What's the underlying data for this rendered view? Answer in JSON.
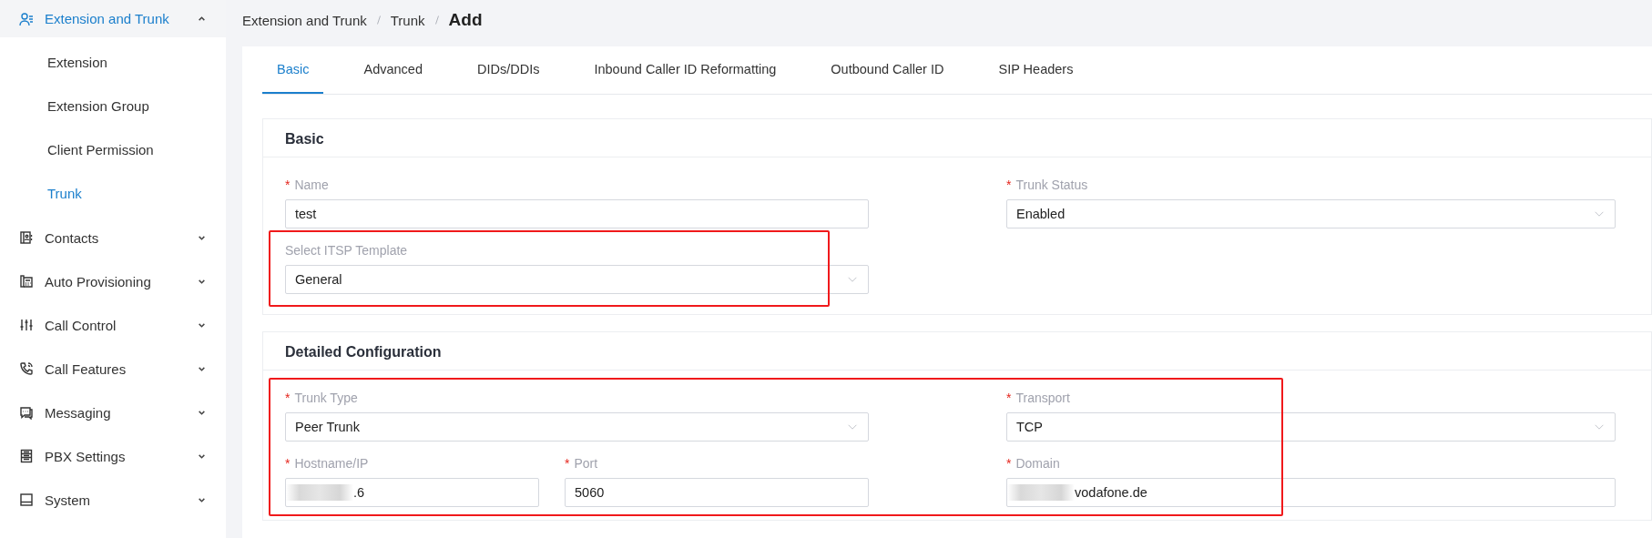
{
  "sidebar": {
    "items": [
      {
        "label": "Extension and Trunk",
        "expanded": true,
        "children": [
          {
            "label": "Extension",
            "selected": false
          },
          {
            "label": "Extension Group",
            "selected": false
          },
          {
            "label": "Client Permission",
            "selected": false
          },
          {
            "label": "Trunk",
            "selected": true
          }
        ]
      },
      {
        "label": "Contacts",
        "expanded": false
      },
      {
        "label": "Auto Provisioning",
        "expanded": false
      },
      {
        "label": "Call Control",
        "expanded": false
      },
      {
        "label": "Call Features",
        "expanded": false
      },
      {
        "label": "Messaging",
        "expanded": false
      },
      {
        "label": "PBX Settings",
        "expanded": false
      },
      {
        "label": "System",
        "expanded": false
      }
    ]
  },
  "breadcrumb": [
    "Extension and Trunk",
    "Trunk"
  ],
  "page_title": "Add",
  "tabs": [
    {
      "label": "Basic",
      "selected": true
    },
    {
      "label": "Advanced",
      "selected": false
    },
    {
      "label": "DIDs/DDIs",
      "selected": false
    },
    {
      "label": "Inbound Caller ID Reformatting",
      "selected": false
    },
    {
      "label": "Outbound Caller ID",
      "selected": false
    },
    {
      "label": "SIP Headers",
      "selected": false
    }
  ],
  "sections": [
    {
      "title": "Basic",
      "groups": [
        {
          "highlighted": false,
          "rows": [
            {
              "fields": [
                {
                  "kind": "text",
                  "required_mark": "*",
                  "label": "Name",
                  "value": "test"
                },
                {
                  "kind": "select",
                  "required_mark": "*",
                  "label": "Trunk Status",
                  "value": "Enabled"
                }
              ]
            }
          ]
        },
        {
          "highlighted": true,
          "rows": [
            {
              "fields": [
                {
                  "kind": "select",
                  "label": "Select ITSP Template",
                  "value": "General"
                }
              ]
            }
          ]
        }
      ]
    },
    {
      "title": "Detailed Configuration",
      "groups": [
        {
          "highlighted": true,
          "rows": [
            {
              "fields": [
                {
                  "kind": "select",
                  "required_mark": "*",
                  "label": "Trunk Type",
                  "value": "Peer Trunk"
                },
                {
                  "kind": "select",
                  "required_mark": "*",
                  "label": "Transport",
                  "value": "TCP"
                }
              ]
            },
            {
              "fields": [
                {
                  "kind": "text",
                  "required_mark": "*",
                  "label": "Hostname/IP",
                  "value": ".6",
                  "redacted": true
                },
                {
                  "kind": "text",
                  "required_mark": "*",
                  "label": "Port",
                  "value": "5060"
                },
                {
                  "kind": "text",
                  "required_mark": "*",
                  "label": "Domain",
                  "value": "vodafone.de",
                  "redacted": true
                }
              ]
            }
          ]
        }
      ]
    }
  ]
}
